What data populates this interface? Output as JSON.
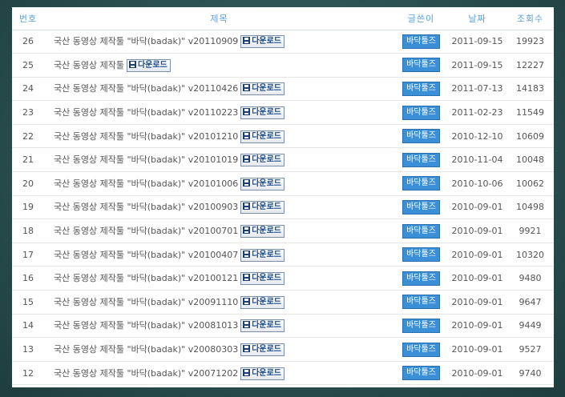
{
  "headers": {
    "num": "번호",
    "title": "제목",
    "author": "글쓴이",
    "date": "날짜",
    "views": "조회수"
  },
  "download_label": "다운로드",
  "author_name": "바닥툴즈",
  "rows": [
    {
      "num": "26",
      "title": "국산 동영상 제작툴 \"바닥(badak)\" v20110909",
      "date": "2011-09-15",
      "views": "19923"
    },
    {
      "num": "25",
      "title": "국산 동영상 제작툴",
      "date": "2011-09-15",
      "views": "12227"
    },
    {
      "num": "24",
      "title": "국산 동영상 제작툴 \"바닥(badak)\" v20110426",
      "date": "2011-07-13",
      "views": "14183"
    },
    {
      "num": "23",
      "title": "국산 동영상 제작툴 \"바닥(badak)\" v20110223",
      "date": "2011-02-23",
      "views": "11549"
    },
    {
      "num": "22",
      "title": "국산 동영상 제작툴 \"바닥(badak)\" v20101210",
      "date": "2010-12-10",
      "views": "10609"
    },
    {
      "num": "21",
      "title": "국산 동영상 제작툴 \"바닥(badak)\" v20101019",
      "date": "2010-11-04",
      "views": "10048"
    },
    {
      "num": "20",
      "title": "국산 동영상 제작툴 \"바닥(badak)\" v20101006",
      "date": "2010-10-06",
      "views": "10062"
    },
    {
      "num": "19",
      "title": "국산 동영상 제작툴 \"바닥(badak)\" v20100903",
      "date": "2010-09-01",
      "views": "10498"
    },
    {
      "num": "18",
      "title": "국산 동영상 제작툴 \"바닥(badak)\" v20100701",
      "date": "2010-09-01",
      "views": "9921"
    },
    {
      "num": "17",
      "title": "국산 동영상 제작툴 \"바닥(badak)\" v20100407",
      "date": "2010-09-01",
      "views": "10320"
    },
    {
      "num": "16",
      "title": "국산 동영상 제작툴 \"바닥(badak)\" v20100121",
      "date": "2010-09-01",
      "views": "9480"
    },
    {
      "num": "15",
      "title": "국산 동영상 제작툴 \"바닥(badak)\" v20091110",
      "date": "2010-09-01",
      "views": "9647"
    },
    {
      "num": "14",
      "title": "국산 동영상 제작툴 \"바닥(badak)\" v20081013",
      "date": "2010-09-01",
      "views": "9449"
    },
    {
      "num": "13",
      "title": "국산 동영상 제작툴 \"바닥(badak)\" v20080303",
      "date": "2010-09-01",
      "views": "9527"
    },
    {
      "num": "12",
      "title": "국산 동영상 제작툴 \"바닥(badak)\" v20071202",
      "date": "2010-09-01",
      "views": "9740"
    }
  ],
  "colors": {
    "header_text": "#5aa0d8",
    "badge_bg": "#3a8fd6",
    "download_text": "#1a4a8a",
    "background": "#2d5657"
  }
}
